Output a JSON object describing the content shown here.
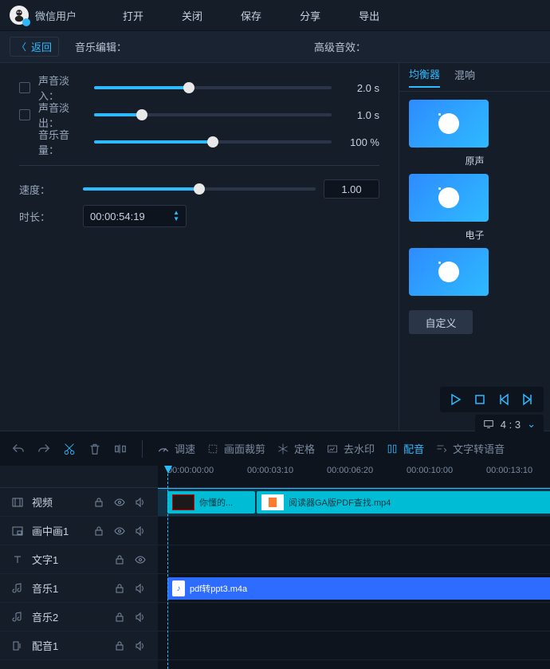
{
  "menubar": {
    "user": "微信用户",
    "items": [
      "打开",
      "关闭",
      "保存",
      "分享",
      "导出"
    ]
  },
  "subhead": {
    "back": "返回",
    "title_left": "音乐编辑：",
    "title_right": "高级音效："
  },
  "controls": {
    "fade_in_label": "声音淡入：",
    "fade_in_value": "2.0 s",
    "fade_in_pct": 40,
    "fade_out_label": "声音淡出：",
    "fade_out_value": "1.0 s",
    "fade_out_pct": 20,
    "volume_label": "音乐音量：",
    "volume_value": "100 %",
    "volume_pct": 50,
    "speed_label": "速度：",
    "speed_value": "1.00",
    "speed_pct": 50,
    "duration_label": "时长：",
    "duration_value": "00:00:54:19"
  },
  "effects_panel": {
    "tabs": {
      "eq": "均衡器",
      "reverb": "混响"
    },
    "items": [
      "原声",
      "电子"
    ],
    "custom_label": "自定义"
  },
  "playback": {
    "aspect": "4 : 3"
  },
  "toolbar": {
    "speed": "调速",
    "crop": "画面裁剪",
    "freeze": "定格",
    "watermark": "去水印",
    "dub": "配音",
    "tts": "文字转语音"
  },
  "timeline": {
    "ticks": [
      "00:00:00:00",
      "00:00:03:10",
      "00:00:06:20",
      "00:00:10:00",
      "00:00:13:10"
    ],
    "tracks": {
      "video": "视频",
      "pip": "画中画1",
      "text": "文字1",
      "music1": "音乐1",
      "music2": "音乐2",
      "dub": "配音1"
    },
    "clips": {
      "video1_label": "你懂的...",
      "video2_label": "阅读器GA版PDF查找.mp4",
      "audio_label": "pdf转ppt3.m4a"
    }
  }
}
